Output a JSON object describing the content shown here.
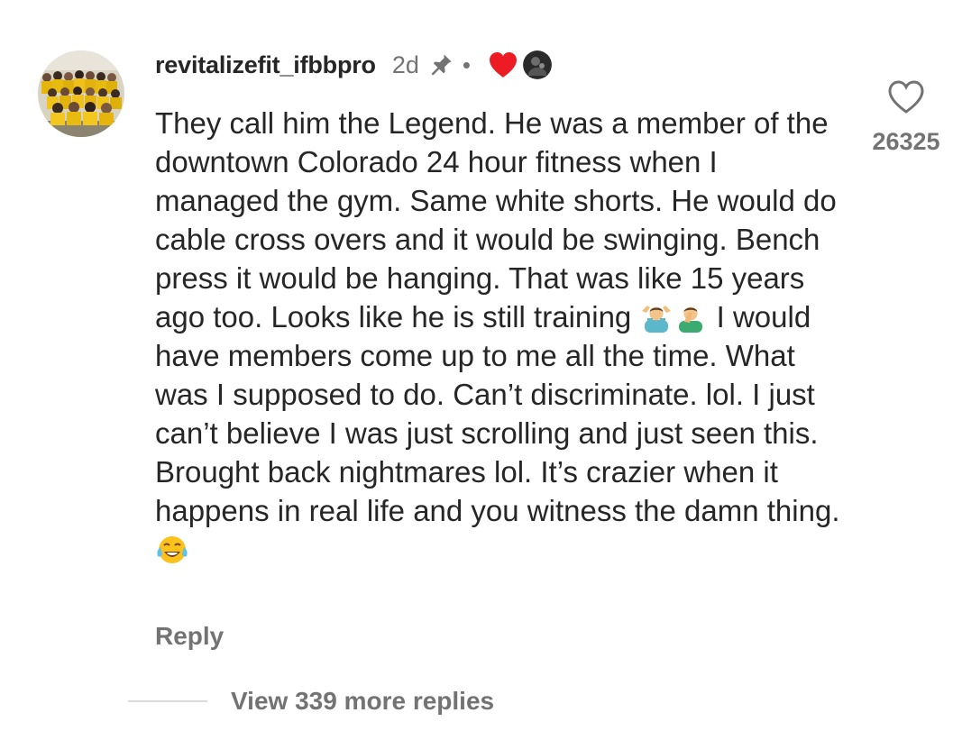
{
  "comment": {
    "username": "revitalizefit_ifbbpro",
    "timestamp": "2d",
    "separator": "•",
    "icons": {
      "pin": "pin-icon",
      "liked_by_author": "heart-red-icon",
      "author_avatar": "mini-avatar"
    },
    "text_part1": "They call him the Legend. He was a member of the downtown Colorado 24 hour fitness when I managed the gym. Same white shorts. He would do cable cross overs and it would be swinging. Bench press it would be hanging. That was like 15 years ago too. Looks like he is still training ",
    "text_part2": " I would have members come up to me all the time. What was I supposed to do. Can’t discriminate. lol. I just can’t believe I was just scrolling and just seen this. Brought back nightmares lol. It’s crazier when it happens in real life and you witness the damn thing. ",
    "emojis": [
      "man-shrugging-emoji",
      "man-facepalming-emoji",
      "tears-of-joy-emoji"
    ],
    "like_count": "26325",
    "reply_label": "Reply",
    "view_replies_label": "View 339 more replies"
  },
  "colors": {
    "text": "#262626",
    "secondary": "#737373",
    "heart_red": "#ed1c24",
    "divider": "#dbdbdb"
  }
}
